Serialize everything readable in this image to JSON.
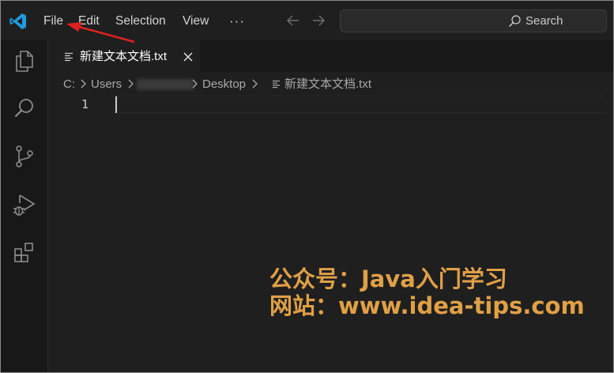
{
  "menu": {
    "file": "File",
    "edit": "Edit",
    "selection": "Selection",
    "view": "View",
    "more": "···"
  },
  "search": {
    "label": "Search"
  },
  "tab": {
    "title": "新建文本文档.txt"
  },
  "breadcrumb": {
    "drive": "C:",
    "users": "Users",
    "desktop": "Desktop",
    "filename": "新建文本文档.txt"
  },
  "editor": {
    "line_number": "1"
  },
  "watermark": {
    "line1": "公众号：Java入门学习",
    "line2": "网站：www.idea-tips.com"
  },
  "colors": {
    "accent": "#0078d4",
    "watermark": "#e0a046",
    "annotation_arrow": "#e02020"
  },
  "icons": {
    "logo": "vscode-logo-icon",
    "explorer": "files-icon",
    "search": "search-icon",
    "scm": "source-control-icon",
    "debug": "run-debug-icon",
    "extensions": "extensions-icon"
  }
}
